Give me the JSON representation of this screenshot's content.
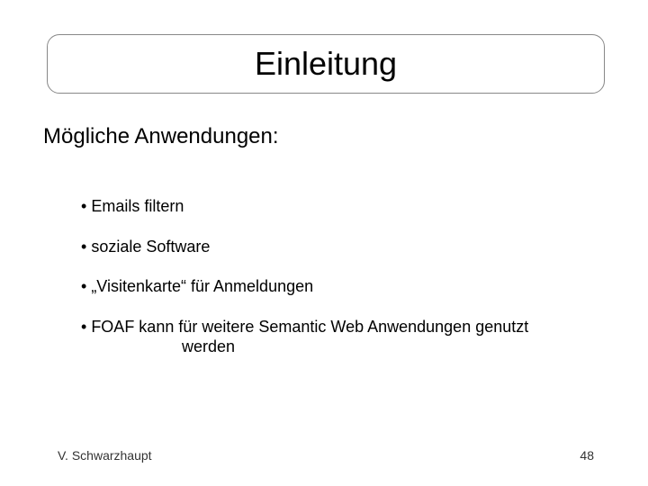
{
  "title": "Einleitung",
  "subheading": "Mögliche Anwendungen:",
  "bullets": [
    "Emails filtern",
    "soziale Software",
    "„Visitenkarte“ für Anmeldungen"
  ],
  "bullet_wrapped": {
    "line1": "FOAF kann für weitere Semantic Web Anwendungen genutzt",
    "line2": "werden"
  },
  "footer": {
    "author": "V. Schwarzhaupt",
    "page": "48"
  }
}
